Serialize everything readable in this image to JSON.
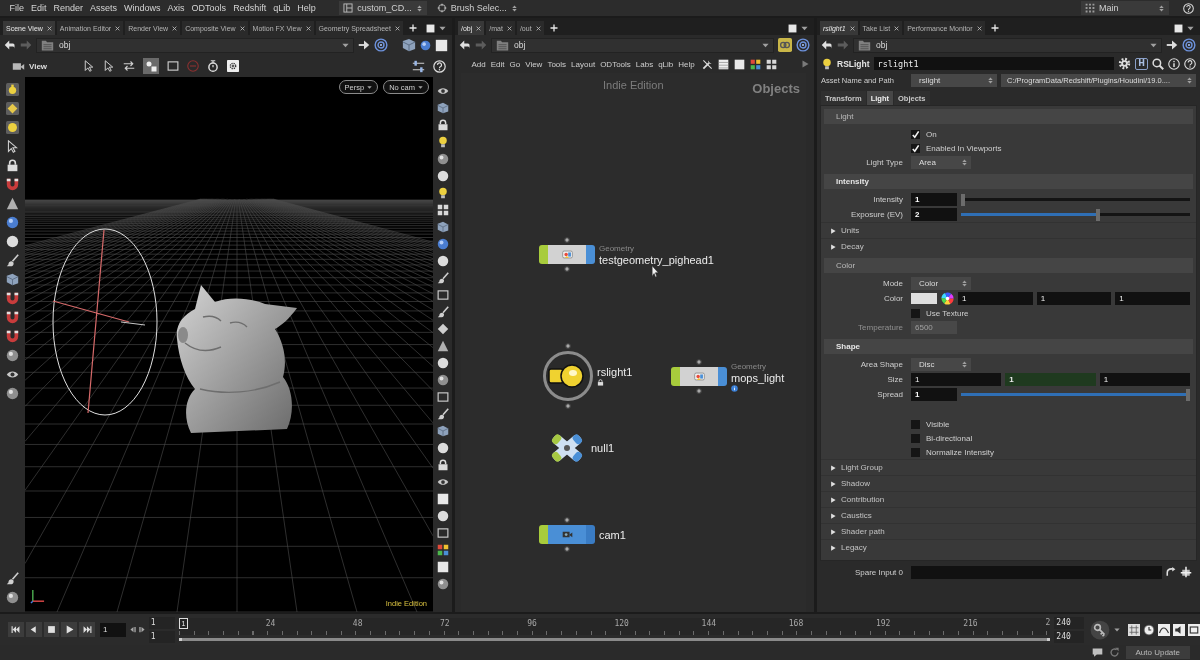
{
  "menu_bar": {
    "items": [
      "File",
      "Edit",
      "Render",
      "Assets",
      "Windows",
      "Axis",
      "ODTools",
      "Redshift",
      "qLib",
      "Help"
    ],
    "desktop": "custom_CD...",
    "shelf_tool": "Brush Selec...",
    "desktop_menu": "Main"
  },
  "scene_pane": {
    "tabs": [
      {
        "label": "Scene View",
        "selected": true
      },
      {
        "label": "Animation Editor",
        "selected": false
      },
      {
        "label": "Render View",
        "selected": false
      },
      {
        "label": "Composite View",
        "selected": false
      },
      {
        "label": "Motion FX View",
        "selected": false
      },
      {
        "label": "Geometry Spreadsheet",
        "selected": false
      }
    ],
    "path": "obj",
    "toolbar_label": "View",
    "camera_menus": [
      "Persp",
      "No cam"
    ],
    "edition": "Indie Edition"
  },
  "network_pane": {
    "tabs": [
      {
        "label": "/obj",
        "selected": true
      },
      {
        "label": "/mat",
        "selected": false
      },
      {
        "label": "/out",
        "selected": false
      }
    ],
    "path": "obj",
    "menu": [
      "Add",
      "Edit",
      "Go",
      "View",
      "Tools",
      "Layout",
      "ODTools",
      "Labs",
      "qLib",
      "Help"
    ],
    "edition": "Indie Edition",
    "context": "Objects",
    "nodes": [
      {
        "kind": "geometry",
        "type": "Geometry",
        "name": "testgeometry_pighead1",
        "locked": false,
        "info": false
      },
      {
        "kind": "light",
        "name": "rslight1",
        "locked": true,
        "info": false
      },
      {
        "kind": "geometry",
        "type": "Geometry",
        "name": "mops_light",
        "locked": false,
        "info": true
      },
      {
        "kind": "null",
        "name": "null1",
        "locked": false,
        "info": false
      },
      {
        "kind": "camera",
        "name": "cam1",
        "locked": false,
        "info": false
      }
    ]
  },
  "parameter_pane": {
    "tabs": [
      {
        "label": "rslight1",
        "selected": true
      },
      {
        "label": "Take List",
        "selected": false
      },
      {
        "label": "Performance Monitor",
        "selected": false
      }
    ],
    "path": "obj",
    "node_type": "RSLight",
    "node_name": "rslight1",
    "hda_glyph": "H",
    "asset": {
      "label": "Asset Name and Path",
      "name": "rslight",
      "path": "C:/ProgramData/Redshift/Plugins/Houdini/19.0...."
    },
    "folder_tabs": [
      {
        "label": "Transform",
        "selected": false
      },
      {
        "label": "Light",
        "selected": true
      },
      {
        "label": "Objects",
        "selected": false
      }
    ],
    "params": [
      {
        "kind": "section",
        "title": "Light",
        "bold": false
      },
      {
        "kind": "checkbox",
        "label": "On",
        "checked": true
      },
      {
        "kind": "checkbox",
        "label": "Enabled In Viewports",
        "checked": true
      },
      {
        "kind": "menu",
        "label": "Light Type",
        "value": "Area"
      },
      {
        "kind": "section",
        "title": "Intensity",
        "bold": true
      },
      {
        "kind": "slider",
        "label": "Intensity",
        "value": "1",
        "level": 0
      },
      {
        "kind": "slider",
        "label": "Exposure (EV)",
        "value": "2",
        "level": 0.6
      },
      {
        "kind": "folder",
        "label": "Units",
        "expanded": false
      },
      {
        "kind": "folder",
        "label": "Decay",
        "expanded": false
      },
      {
        "kind": "section",
        "title": "Color",
        "bold": false
      },
      {
        "kind": "menu",
        "label": "Mode",
        "value": "Color"
      },
      {
        "kind": "color",
        "label": "Color",
        "values": [
          "1",
          "1",
          "1"
        ]
      },
      {
        "kind": "checkbox",
        "label": "Use Texture",
        "checked": false
      },
      {
        "kind": "field",
        "label": "Temperature",
        "value": "6500",
        "disabled": true
      },
      {
        "kind": "section",
        "title": "Shape",
        "bold": true
      },
      {
        "kind": "menu",
        "label": "Area Shape",
        "value": "Disc"
      },
      {
        "kind": "vector",
        "label": "Size",
        "values": [
          {
            "value": "1",
            "selected": false
          },
          {
            "value": "1",
            "selected": true
          },
          {
            "value": "1",
            "selected": false
          }
        ]
      },
      {
        "kind": "slider",
        "label": "Spread",
        "value": "1",
        "level": 1
      },
      {
        "kind": "checkbox",
        "label": "Visible",
        "checked": false
      },
      {
        "kind": "checkbox",
        "label": "Bi-directional",
        "checked": false
      },
      {
        "kind": "checkbox",
        "label": "Normalize Intensity",
        "checked": false
      },
      {
        "kind": "folder",
        "label": "Light Group",
        "expanded": false
      },
      {
        "kind": "folder",
        "label": "Shadow",
        "expanded": false
      },
      {
        "kind": "folder",
        "label": "Contribution",
        "expanded": false
      },
      {
        "kind": "folder",
        "label": "Caustics",
        "expanded": false
      },
      {
        "kind": "folder",
        "label": "Shader path",
        "expanded": false
      },
      {
        "kind": "folder",
        "label": "Legacy",
        "expanded": false
      }
    ],
    "spare_input": "Spare Input 0"
  },
  "timeline": {
    "frame": "1",
    "range_start": [
      "1",
      "1"
    ],
    "current_frame": "1",
    "ticks": [
      "24",
      "48",
      "72",
      "96",
      "120",
      "144",
      "168",
      "192",
      "216",
      "2"
    ],
    "range_end": [
      "240",
      "240"
    ]
  },
  "status_bar": {
    "button": "Auto Update"
  }
}
